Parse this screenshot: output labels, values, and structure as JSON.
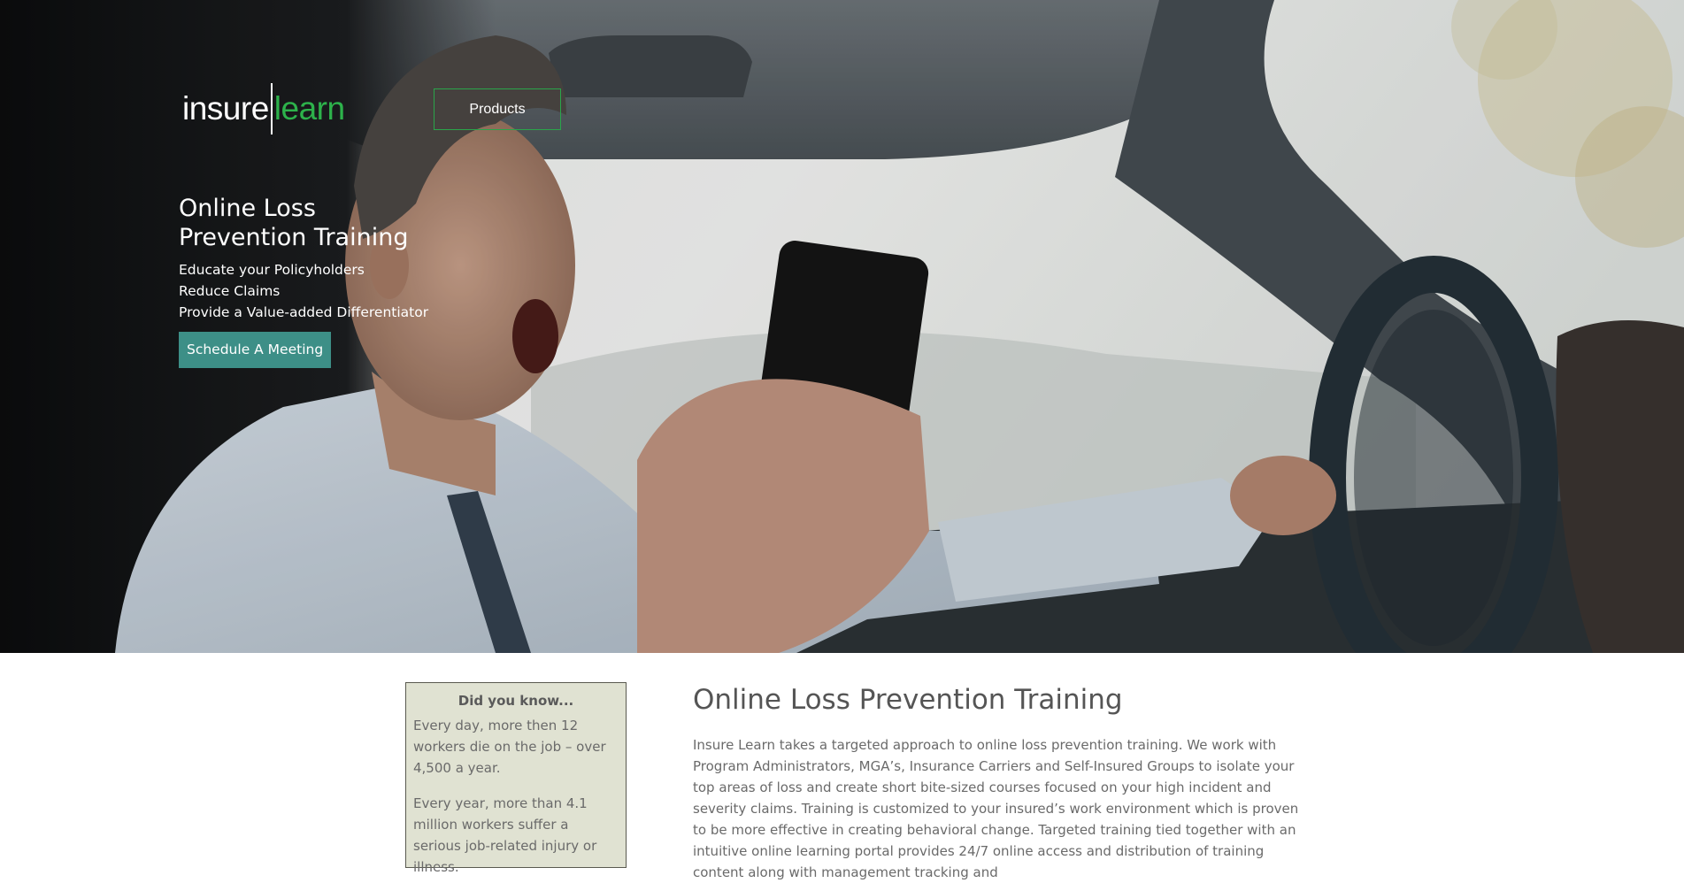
{
  "brand": {
    "logo_left": "insure",
    "logo_right": "learn",
    "accent_green": "#2db24b",
    "cta_color": "#3d8f87"
  },
  "nav": {
    "products_label": "Products"
  },
  "hero": {
    "title": "Online Loss Prevention Training",
    "lines": [
      "Educate your Policyholders",
      "Reduce Claims",
      "Provide a Value-added Differentiator"
    ],
    "cta_label": "Schedule A Meeting"
  },
  "did_you_know": {
    "title": "Did you know...",
    "facts": [
      "Every day, more then 12 workers die on the job – over 4,500 a year.",
      "Every year, more than 4.1 million workers suffer a serious job-related injury or illness."
    ]
  },
  "main": {
    "title": "Online Loss Prevention Training",
    "body": "Insure Learn takes a targeted approach to online loss prevention training. We work with Program Administrators, MGA’s, Insurance Carriers and Self-Insured Groups to isolate your top areas of loss and create short bite-sized courses focused on your high incident and severity claims. Training is customized to your insured’s work environment which is proven to be more effective in creating behavioral change. Targeted training tied together with an intuitive online learning portal provides 24/7 online access and distribution of training content along with management tracking and"
  }
}
